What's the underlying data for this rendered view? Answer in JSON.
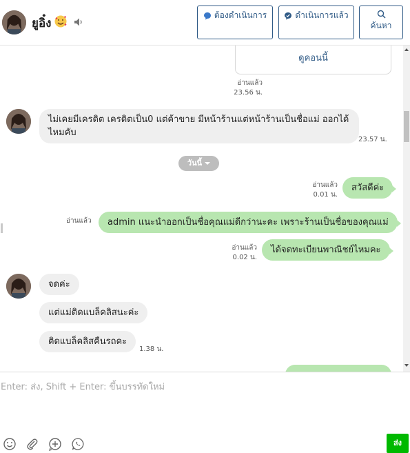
{
  "header": {
    "contact_name": "ยูอิ๋ง",
    "buttons": {
      "todo_label": "ต้องดำเนินการ",
      "done_label": "ดำเนินการแล้ว",
      "search_label": "ค้นหา"
    },
    "icons": {
      "emoji": "smiling-face-hearts-icon",
      "speaker": "speaker-icon"
    }
  },
  "chat": {
    "coupon_card": {
      "link_label": "ดูคอนนี้"
    },
    "day_divider": "วันนี้",
    "messages": [
      {
        "side": "out",
        "read": "อ่านแล้ว",
        "time": "23.56 น.",
        "text": ""
      },
      {
        "side": "in",
        "text": "ไม่เคยมีเครดิต เครดิตเป็น0 แต่ค้าขาย มีหน้าร้านแต่หน้าร้านเป็นชื่อแม่ ออกได้ไหมคับ",
        "time": "23.57 น."
      },
      {
        "side": "out",
        "read": "อ่านแล้ว",
        "time": "0.01 น.",
        "text": "สวัสดีค่ะ"
      },
      {
        "side": "out",
        "read": "อ่านแล้ว",
        "time": "",
        "text": "admin แนะนำออกเป็นชื่อคุณแม่ดีกว่านะคะ เพราะร้านเป็นชื่อของคุณแม่"
      },
      {
        "side": "out",
        "read": "อ่านแล้ว",
        "time": "0.02 น.",
        "text": "ได้จดทะเบียนพาณิชย์ไหมคะ"
      },
      {
        "side": "in",
        "text": "จดค่ะ",
        "time": ""
      },
      {
        "side": "in",
        "text": "แต่แม่ติดแบล็คลิสนะค่ะ",
        "time": ""
      },
      {
        "side": "in",
        "text": "ติดแบล็คลิสคืนรถคะ",
        "time": "1.38 น."
      }
    ]
  },
  "composer": {
    "placeholder": "Enter: ส่ง, Shift + Enter: ขึ้นบรรทัดใหม่",
    "send_label": "ส่ง",
    "tools": [
      "emoji-icon",
      "attachment-icon",
      "add-icon",
      "voice-call-icon"
    ]
  },
  "colors": {
    "outgoing_bubble": "#b8e6b0",
    "incoming_bubble": "#efefef",
    "accent_blue": "#2f5a86",
    "send_green": "#00b900"
  }
}
